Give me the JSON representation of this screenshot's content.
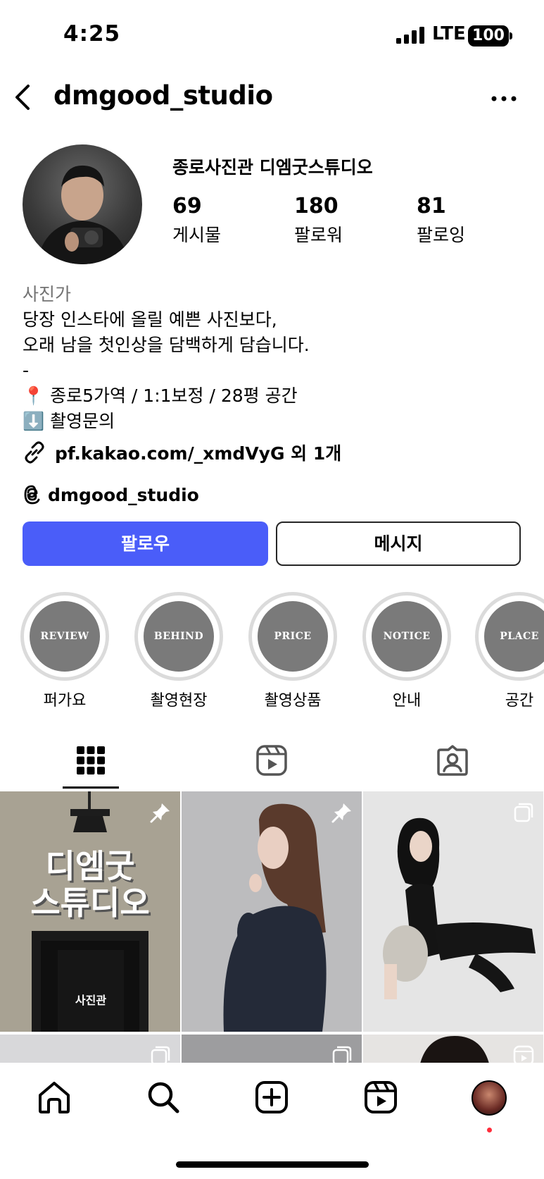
{
  "status_bar": {
    "time": "4:25",
    "network": "LTE",
    "battery": "100"
  },
  "header": {
    "username": "dmgood_studio"
  },
  "profile": {
    "display_name": "종로사진관 디엠굿스튜디오",
    "stats": [
      {
        "value": "69",
        "label": "게시물"
      },
      {
        "value": "180",
        "label": "팔로워"
      },
      {
        "value": "81",
        "label": "팔로잉"
      }
    ],
    "bio": {
      "category": "사진가",
      "lines": [
        "당장 인스타에 올릴 예쁜 사진보다,",
        "오래 남을 첫인상을 담백하게 담습니다.",
        "-",
        "📍 종로5가역 / 1:1보정 / 28평 공간",
        "⬇️ 촬영문의"
      ]
    },
    "link": "pf.kakao.com/_xmdVyG 외 1개",
    "threads_handle": "dmgood_studio"
  },
  "actions": {
    "follow": "팔로우",
    "message": "메시지"
  },
  "highlights": [
    {
      "cover": "REVIEW",
      "label": "퍼가요"
    },
    {
      "cover": "BEHIND",
      "label": "촬영현장"
    },
    {
      "cover": "PRICE",
      "label": "촬영상품"
    },
    {
      "cover": "NOTICE",
      "label": "안내"
    },
    {
      "cover": "PLACE",
      "label": "공간"
    }
  ],
  "posts": {
    "studio_sign": {
      "title": "디엠굿\n스튜디오",
      "door_label": "사진관"
    }
  },
  "colors": {
    "accent": "#4a5df9",
    "notification": "#ff2d3b",
    "muted": "#737373"
  }
}
